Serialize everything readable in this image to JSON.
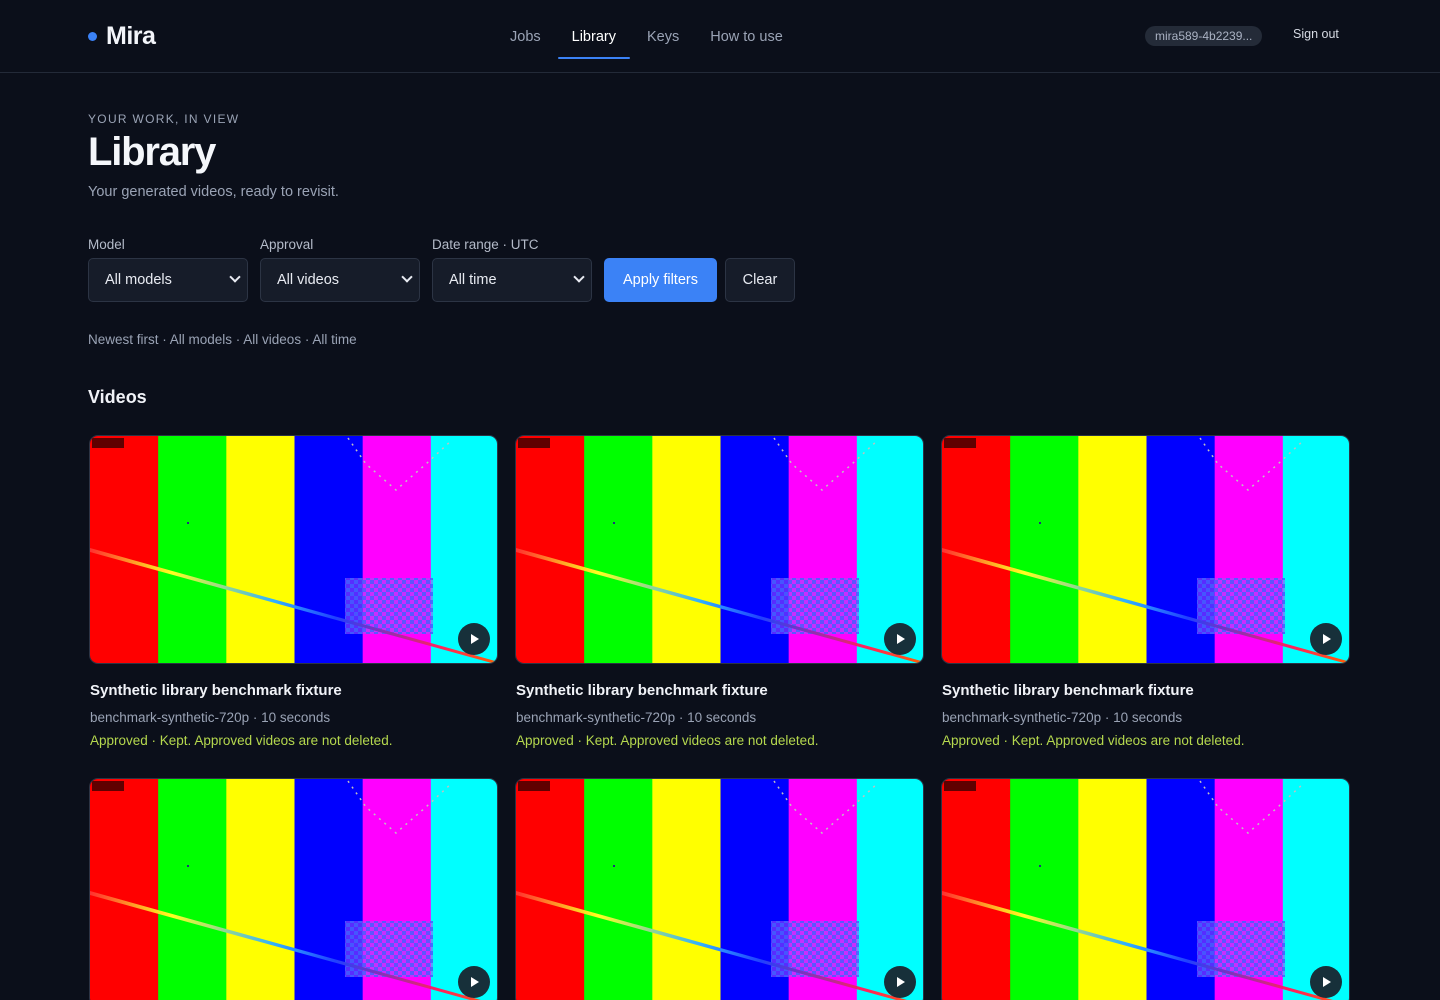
{
  "brand": {
    "name": "Mira",
    "accent": "#3b82f6"
  },
  "nav": {
    "items": [
      {
        "label": "Jobs"
      },
      {
        "label": "Library",
        "active": true
      },
      {
        "label": "Keys"
      },
      {
        "label": "How to use"
      }
    ]
  },
  "account": {
    "id": "mira589-4b2239...",
    "signout": "Sign out"
  },
  "page": {
    "eyebrow": "YOUR WORK, IN VIEW",
    "title": "Library",
    "subtitle": "Your generated videos, ready to revisit."
  },
  "filters": {
    "model": {
      "label": "Model",
      "value": "All models"
    },
    "approval": {
      "label": "Approval",
      "value": "All videos"
    },
    "date": {
      "label": "Date range · UTC",
      "value": "All time"
    },
    "apply": "Apply filters",
    "clear": "Clear",
    "summary": "Newest first · All models · All videos · All time"
  },
  "videos": {
    "title": "Videos",
    "status_color": "#b5d84e",
    "items": [
      {
        "title": "Synthetic library benchmark fixture",
        "meta": "benchmark-synthetic-720p · 10 seconds",
        "status": "Approved · Kept. Approved videos are not deleted."
      },
      {
        "title": "Synthetic library benchmark fixture",
        "meta": "benchmark-synthetic-720p · 10 seconds",
        "status": "Approved · Kept. Approved videos are not deleted."
      },
      {
        "title": "Synthetic library benchmark fixture",
        "meta": "benchmark-synthetic-720p · 10 seconds",
        "status": "Approved · Kept. Approved videos are not deleted."
      },
      {
        "title": "",
        "meta": "",
        "status": ""
      },
      {
        "title": "",
        "meta": "",
        "status": ""
      },
      {
        "title": "",
        "meta": "",
        "status": ""
      }
    ]
  },
  "thumbnail": {
    "bar_colors": [
      "#ff0000",
      "#00ff00",
      "#ffff00",
      "#0000ff",
      "#ff00ff",
      "#00ffff"
    ]
  }
}
